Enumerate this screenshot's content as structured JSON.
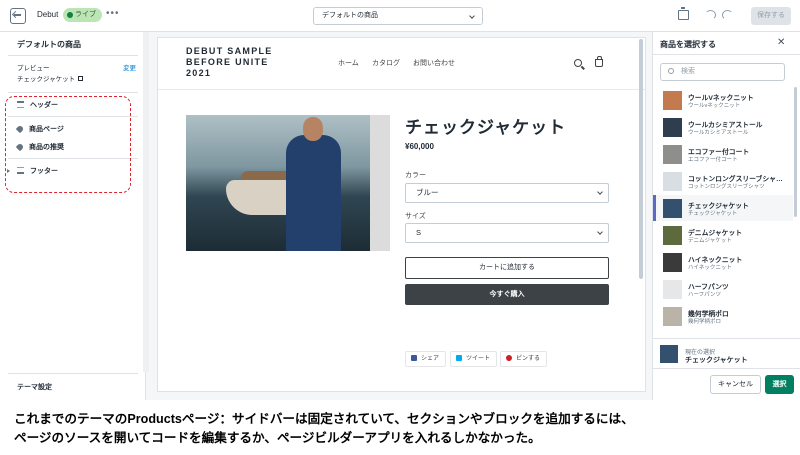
{
  "topbar": {
    "theme_name": "Debut",
    "live_badge": "ライブ",
    "more": "•••",
    "template": "デフォルトの商品",
    "save_label": "保存する"
  },
  "sidebar": {
    "title": "デフォルトの商品",
    "preview_label": "プレビュー",
    "change_label": "変更",
    "preview_value": "チェックジャケット",
    "items": [
      {
        "label": "ヘッダー"
      },
      {
        "label": "商品ページ"
      },
      {
        "label": "商品の推奨"
      },
      {
        "label": "フッター"
      }
    ],
    "theme_settings": "テーマ設定"
  },
  "preview": {
    "logo": "DEBUT SAMPLE BEFORE UNITE 2021",
    "nav": [
      "ホーム",
      "カタログ",
      "お問い合わせ"
    ],
    "product_title": "チェックジャケット",
    "price": "¥60,000",
    "color_label": "カラー",
    "color_value": "ブルー",
    "size_label": "サイズ",
    "size_value": "S",
    "add_to_cart": "カートに追加する",
    "buy_now": "今すぐ購入",
    "share": [
      {
        "label": "シェア",
        "color": "#3b5998"
      },
      {
        "label": "ツイート",
        "color": "#00aced"
      },
      {
        "label": "ピンする",
        "color": "#cb2027"
      }
    ]
  },
  "rpanel": {
    "title": "商品を選択する",
    "close": "✕",
    "search_placeholder": "検索",
    "products": [
      {
        "name": "ウールVネックニット",
        "sub": "ウールvネックニット"
      },
      {
        "name": "ウールカシミアストール",
        "sub": "ウールカシミアストール"
      },
      {
        "name": "エコファー付コート",
        "sub": "エコファー付コート"
      },
      {
        "name": "コットンロングスリーブシャ…",
        "sub": "コットンロングスリーブシャツ"
      },
      {
        "name": "チェックジャケット",
        "sub": "チェックジャケット"
      },
      {
        "name": "デニムジャケット",
        "sub": "デニムジャケット"
      },
      {
        "name": "ハイネックニット",
        "sub": "ハイネックニット"
      },
      {
        "name": "ハーフパンツ",
        "sub": "ハーフパンツ"
      },
      {
        "name": "幾何学柄ポロ",
        "sub": "幾何学柄ポロ"
      }
    ],
    "selected_index": 4,
    "current_label": "現在の選択",
    "current_value": "チェックジャケット",
    "cancel": "キャンセル",
    "choose": "選択"
  },
  "caption": {
    "line1": "これまでのテーマのProductsページ：サイドバーは固定されていて、セクションやブロックを追加するには、",
    "line2": "ページのソースを開いてコードを編集するか、ページビルダーアプリを入れるしかなかった。"
  },
  "colors": {
    "accent": "#5c6ac4",
    "choose_button": "#008060",
    "highlight_border": "#e3232b",
    "live_badge": "#bbe5b3"
  }
}
